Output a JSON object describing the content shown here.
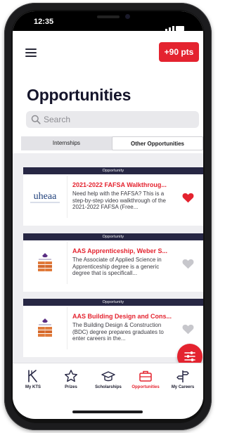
{
  "status_bar": {
    "time": "12:35"
  },
  "header": {
    "points_label": "+90 pts"
  },
  "page": {
    "title": "Opportunities"
  },
  "search": {
    "placeholder": "Search"
  },
  "tabs": [
    {
      "label": "Internships",
      "selected": false
    },
    {
      "label": "Other Opportunities",
      "selected": true
    }
  ],
  "cards": [
    {
      "banner": "Opportunity",
      "logo": "uheaa",
      "title": "2021-2022 FAFSA Walkthroug...",
      "description": "Need help with the FAFSA? This is a step-by-step video walkthrough of the 2021-2022 FAFSA (Free...",
      "favorited": true
    },
    {
      "banner": "Opportunity",
      "logo": "weber-state-logo",
      "title": "AAS Apprenticeship, Weber S...",
      "description": "The Associate of Applied Science in Apprenticeship degree is a generic degree that is specificall...",
      "favorited": false
    },
    {
      "banner": "Opportunity",
      "logo": "weber-state-logo",
      "title": "AAS Building Design and Cons...",
      "description": "The Building Design & Construction (BDC) degree prepares graduates to enter careers in the...",
      "favorited": false
    }
  ],
  "tab_bar": [
    {
      "label": "My KTS",
      "icon": "kts-icon",
      "active": false
    },
    {
      "label": "Prizes",
      "icon": "star-icon",
      "active": false
    },
    {
      "label": "Scholarships",
      "icon": "graduation-cap-icon",
      "active": false
    },
    {
      "label": "Opportunities",
      "icon": "briefcase-icon",
      "active": true
    },
    {
      "label": "My Careers",
      "icon": "signpost-icon",
      "active": false
    }
  ],
  "colors": {
    "accent": "#e4232f",
    "navy": "#272744",
    "title": "#15152b",
    "heart_off": "#c7c7cc"
  }
}
